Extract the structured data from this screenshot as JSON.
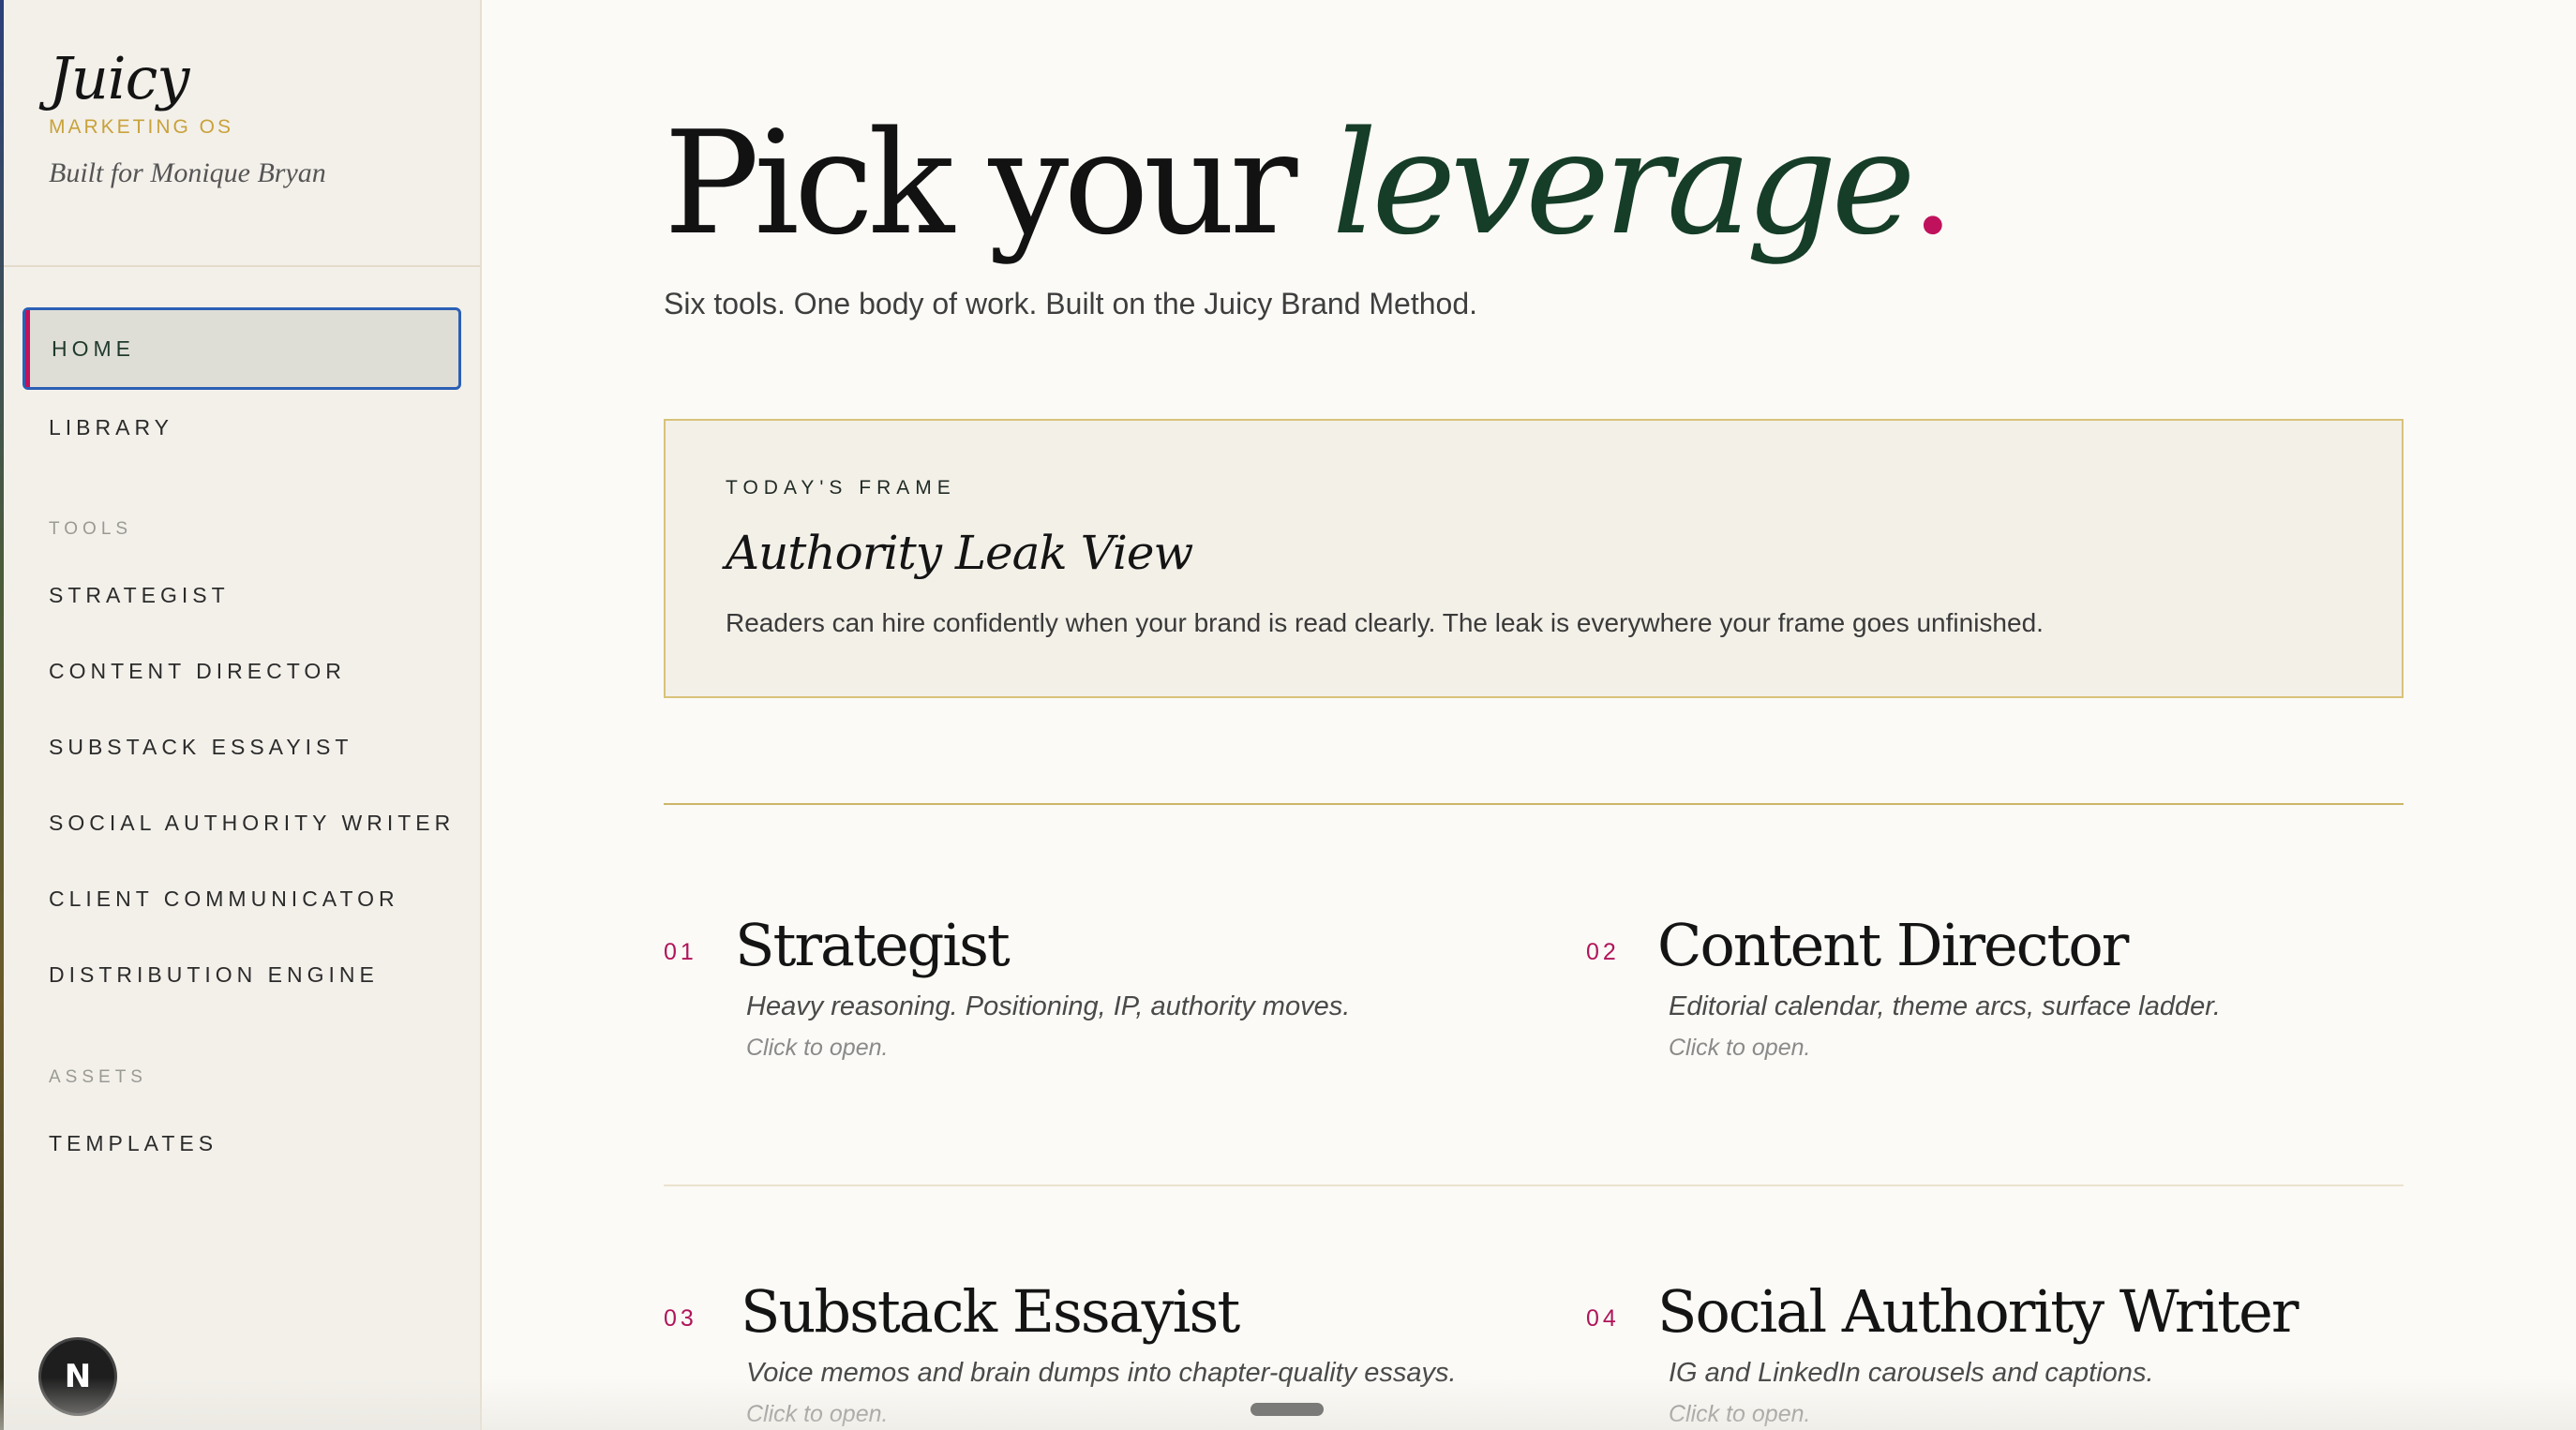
{
  "brand": {
    "name": "Juicy",
    "subtitle": "MARKETING OS",
    "built_for": "Built for Monique Bryan"
  },
  "sidebar": {
    "home": "HOME",
    "library": "LIBRARY",
    "tools_label": "TOOLS",
    "tools": [
      "STRATEGIST",
      "CONTENT DIRECTOR",
      "SUBSTACK ESSAYIST",
      "SOCIAL AUTHORITY WRITER",
      "CLIENT COMMUNICATOR",
      "DISTRIBUTION ENGINE"
    ],
    "assets_label": "ASSETS",
    "assets": [
      "TEMPLATES"
    ],
    "badge": "N"
  },
  "hero": {
    "lead": "Pick your ",
    "accent": "leverage",
    "dot": ".",
    "subtitle": "Six tools. One body of work. Built on the Juicy Brand Method."
  },
  "frame": {
    "kicker": "TODAY'S FRAME",
    "title": "Authority Leak View",
    "text": "Readers can hire confidently when your brand is read clearly. The leak is everywhere your frame goes unfinished."
  },
  "tools": [
    {
      "num": "01",
      "name": "Strategist",
      "desc": "Heavy reasoning. Positioning, IP, authority moves.",
      "cta": "Click to open."
    },
    {
      "num": "02",
      "name": "Content Director",
      "desc": "Editorial calendar, theme arcs, surface ladder.",
      "cta": "Click to open."
    },
    {
      "num": "03",
      "name": "Substack Essayist",
      "desc": "Voice memos and brain dumps into chapter-quality essays.",
      "cta": "Click to open."
    },
    {
      "num": "04",
      "name": "Social Authority Writer",
      "desc": "IG and LinkedIn carousels and captions.",
      "cta": "Click to open."
    }
  ],
  "colors": {
    "accent_green": "#163d27",
    "accent_magenta": "#c0125c",
    "gold": "#c9a23a",
    "focus_blue": "#2a5fb5"
  }
}
